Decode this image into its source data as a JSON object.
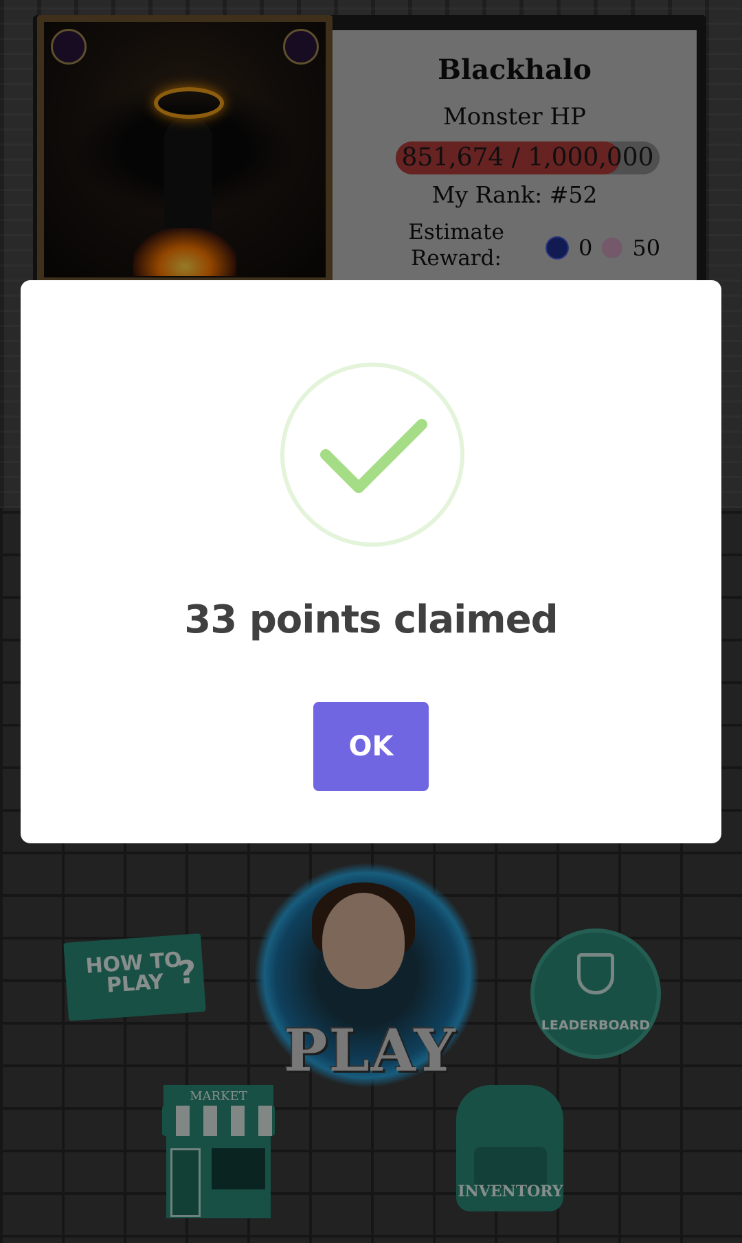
{
  "boss": {
    "name": "Blackhalo",
    "hp_label": "Monster HP",
    "hp_text": "851,674 / 1,000,000",
    "hp_fraction": 0.851674,
    "rank_text": "My Rank: #52",
    "reward_label": "Estimate Reward:",
    "reward_steem": "0",
    "reward_points": "50"
  },
  "modal": {
    "title": "33 points claimed",
    "ok_label": "OK",
    "success_icon": "checkmark-icon",
    "accent_color": "#7166e1",
    "check_color": "#a5dc86"
  },
  "menu": {
    "how_to_play_label": "HOW TO PLAY",
    "play_label": "PLAY",
    "leaderboard_label": "LEADERBOARD",
    "market_label": "MARKET",
    "inventory_label": "INVENTORY"
  }
}
